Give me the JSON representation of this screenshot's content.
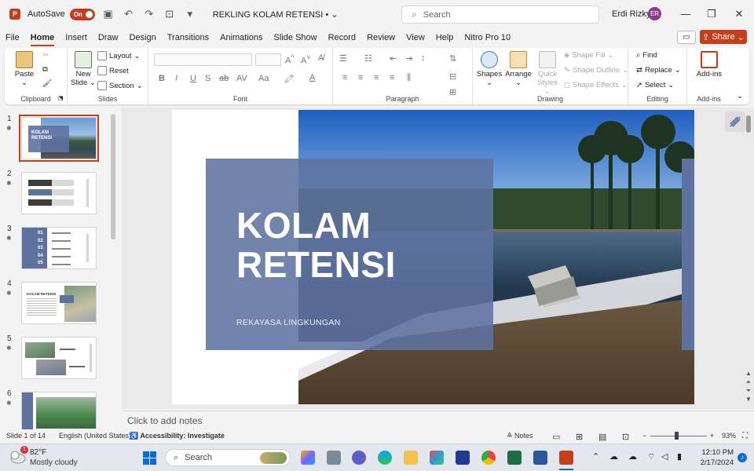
{
  "titlebar": {
    "app_icon": "P",
    "autosave_label": "AutoSave",
    "autosave_state": "On",
    "doc_title": "REKLING KOLAM RETENSI • ",
    "search_placeholder": "Search",
    "user_name": "Erdi Rizky",
    "user_initials": "ER"
  },
  "tabs": [
    "File",
    "Home",
    "Insert",
    "Draw",
    "Design",
    "Transitions",
    "Animations",
    "Slide Show",
    "Record",
    "Review",
    "View",
    "Help",
    "Nitro Pro 10"
  ],
  "active_tab": "Home",
  "share_label": "Share",
  "ribbon": {
    "groups": {
      "clipboard": "Clipboard",
      "slides": "Slides",
      "font": "Font",
      "paragraph": "Paragraph",
      "drawing": "Drawing",
      "editing": "Editing",
      "addins": "Add-ins"
    },
    "paste": "Paste",
    "new_slide_1": "New",
    "new_slide_2": "Slide",
    "layout": "Layout",
    "reset": "Reset",
    "section": "Section",
    "shapes": "Shapes",
    "arrange": "Arrange",
    "quick_styles_1": "Quick",
    "quick_styles_2": "Styles",
    "shape_fill": "Shape Fill",
    "shape_outline": "Shape Outline",
    "shape_effects": "Shape Effects",
    "find": "Find",
    "replace": "Replace",
    "select": "Select",
    "addins_btn": "Add-ins"
  },
  "thumbnails": [
    {
      "num": "1",
      "title": "KOLAM RETENSI"
    },
    {
      "num": "2"
    },
    {
      "num": "3",
      "items": [
        "01",
        "02",
        "03",
        "04",
        "05"
      ]
    },
    {
      "num": "4",
      "title": "KOLAM RETENSI"
    },
    {
      "num": "5"
    },
    {
      "num": "6"
    }
  ],
  "slide": {
    "title": "KOLAM\nRETENSI",
    "subtitle": "REKAYASA LINGKUNGAN",
    "accent_color": "#5e72a0"
  },
  "notes_placeholder": "Click to add notes",
  "status": {
    "slide_of": "Slide 1 of 14",
    "language": "English (United States)",
    "accessibility": "Accessibility: Investigate",
    "notes": "Notes",
    "zoom": "93%"
  },
  "taskbar": {
    "temp": "82°F",
    "weather": "Mostly cloudy",
    "search": "Search",
    "time": "12:10 PM",
    "date": "2/17/2024",
    "notification_badge": "1"
  }
}
